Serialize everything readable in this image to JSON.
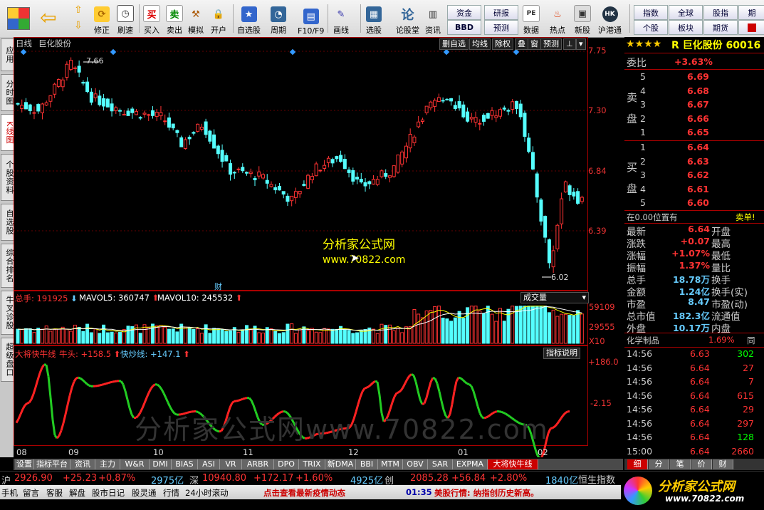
{
  "toolbar": {
    "buttons": [
      "买入",
      "卖出",
      "模拟",
      "开户",
      "自选股",
      "周期",
      "F10/F9",
      "画线",
      "选股",
      "论股堂",
      "资讯",
      "数据",
      "热点",
      "新股",
      "沪港通"
    ],
    "nav": [
      "修正",
      "刷速"
    ],
    "small": [
      "资金",
      "研报",
      "BBD",
      "预测",
      "指数",
      "全球",
      "股指",
      "期货",
      "个股",
      "板块",
      "期货",
      "期"
    ],
    "icon_glyphs": [
      "买",
      "卖",
      "论",
      "PE"
    ]
  },
  "left_tabs": [
    "应用",
    "分时图",
    "K线图",
    "个股资料",
    "自选股",
    "综合排名",
    "牛叉诊股",
    "超级盘口"
  ],
  "kline": {
    "label_left": "日线",
    "stock": "巨化股份",
    "top_buttons": [
      "删自选",
      "均线",
      "除权",
      "叠",
      "窗",
      "预测"
    ],
    "high_label": "7.66",
    "low_label": "6.02",
    "y_ticks": [
      "7.75",
      "7.30",
      "6.84",
      "6.39"
    ],
    "cai": "财",
    "watermark1": "分析家公式网",
    "watermark2": "www.70822.com"
  },
  "volume": {
    "label": "总手: 191925",
    "mavol5": "MAVOL5: 360747",
    "mavol10": "MAVOL10: 245532",
    "selector": "成交量",
    "y_ticks": [
      "59109",
      "29555"
    ],
    "unit": "X10"
  },
  "indicator": {
    "name": "大将快牛线",
    "bull": "牛头: +158.5",
    "fast": "快炒线: +147.1",
    "help": "指标说明",
    "y_top": "+186.0",
    "y_mid": "-2.15",
    "watermark": "分析家公式网www.70822.com"
  },
  "x_labels": [
    "08",
    "09",
    "10",
    "11",
    "12",
    "01",
    "02"
  ],
  "bottom_tabs": [
    "设置",
    "指标平台",
    "资讯",
    "主力",
    "W&R",
    "DMI",
    "BIAS",
    "ASI",
    "VR",
    "ARBR",
    "DPO",
    "TRIX",
    "新DMA",
    "BBI",
    "MTM",
    "OBV",
    "SAR",
    "EXPMA",
    "大将快牛线"
  ],
  "right": {
    "stars": "★★★★",
    "title": "R 巨化股份 60016",
    "weibi_label": "委比",
    "weibi": "+3.63%",
    "sell_label": "卖盘",
    "buy_label": "买盘",
    "sell": [
      [
        "5",
        "6.69"
      ],
      [
        "4",
        "6.68"
      ],
      [
        "3",
        "6.67"
      ],
      [
        "2",
        "6.66"
      ],
      [
        "1",
        "6.65"
      ]
    ],
    "buy": [
      [
        "1",
        "6.64"
      ],
      [
        "2",
        "6.63"
      ],
      [
        "3",
        "6.62"
      ],
      [
        "4",
        "6.61"
      ],
      [
        "5",
        "6.60"
      ]
    ],
    "pos_text": "在0.00位置有",
    "pos_right": "卖单!",
    "stats": [
      [
        "最新",
        "6.64",
        "开盘",
        ""
      ],
      [
        "涨跌",
        "+0.07",
        "最高",
        ""
      ],
      [
        "涨幅",
        "+1.07%",
        "最低",
        ""
      ],
      [
        "振幅",
        "1.37%",
        "量比",
        ""
      ],
      [
        "总手",
        "18.78万",
        "换手",
        ""
      ],
      [
        "金额",
        "1.24亿",
        "换手(实)",
        ""
      ],
      [
        "市盈",
        "8.47",
        "市盈(动)",
        ""
      ],
      [
        "总市值",
        "182.3亿",
        "流通值",
        ""
      ],
      [
        "外盘",
        "10.17万",
        "内盘",
        ""
      ]
    ],
    "sector": "化学制品",
    "sector_pct": "1.69%",
    "sector_tail": "同",
    "ticks": [
      [
        "14:56",
        "6.63",
        "302"
      ],
      [
        "14:56",
        "6.64",
        "27"
      ],
      [
        "14:56",
        "6.64",
        "7"
      ],
      [
        "14:56",
        "6.64",
        "615"
      ],
      [
        "14:56",
        "6.64",
        "29"
      ],
      [
        "14:56",
        "6.64",
        "297"
      ],
      [
        "14:56",
        "6.64",
        "128"
      ],
      [
        "15:00",
        "6.64",
        "2660"
      ]
    ],
    "footer_tabs": [
      "细",
      "分",
      "笔",
      "价",
      "财"
    ]
  },
  "status": {
    "sh_label": "沪",
    "sh_val": "2926.90",
    "sh_chg": "+25.23",
    "sh_pct": "+0.87%",
    "sh_amt": "2975亿",
    "sz_label": "深",
    "sz_val": "10940.80",
    "sz_chg": "+172.17",
    "sz_pct": "+1.60%",
    "sz_amt": "4925亿",
    "cy_label": "创",
    "cy_val": "2085.28",
    "cy_chg": "+56.84",
    "cy_pct": "+2.80%",
    "cy_amt": "1840亿",
    "hs_label": "恒生指数"
  },
  "bottombar": {
    "items": [
      "手机",
      "留言",
      "客服",
      "解盘",
      "股市日记",
      "股灵通",
      "行情",
      "24小时滚动"
    ],
    "news": "点击查看最新疫情动态",
    "time": "01:35",
    "news2": "美股行情: 纳指创历史新高。",
    "logo": "分析家公式网",
    "logo_url": "www.70822.com"
  }
}
